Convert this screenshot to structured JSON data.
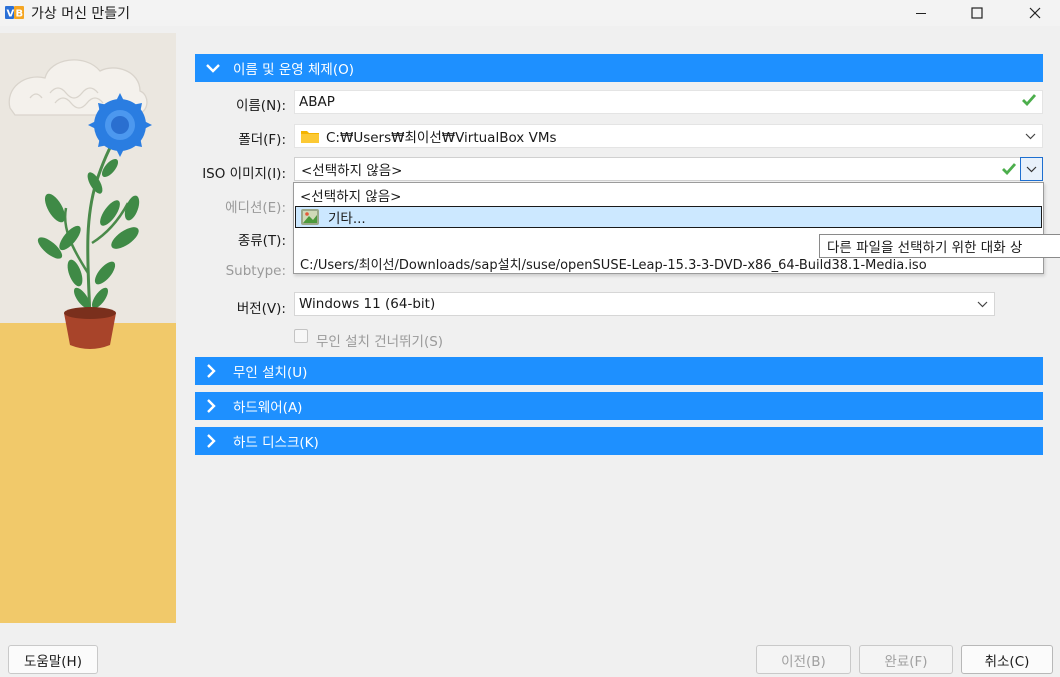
{
  "window": {
    "title": "가상 머신 만들기"
  },
  "sections": {
    "name_os": "이름 및 운영 체제(O)",
    "unattended": "무인 설치(U)",
    "hardware": "하드웨어(A)",
    "harddisk": "하드 디스크(K)"
  },
  "form": {
    "name_label": "이름(N):",
    "name_value": "ABAP",
    "folder_label": "폴더(F):",
    "folder_value": "C:₩Users₩최이선₩VirtualBox VMs",
    "iso_label": "ISO 이미지(I):",
    "iso_value": "<선택하지 않음>",
    "edition_label": "에디션(E):",
    "type_label": "종류(T):",
    "subtype_label": "Subtype:",
    "version_label": "버전(V):",
    "version_value": "Windows 11 (64-bit)",
    "skip_unattended_label": "무인 설치 건너뛰기(S)"
  },
  "iso_dropdown": {
    "items": [
      "<선택하지 않음>",
      "기타...",
      "C:/Users/최이선/Downloads/sap설치/suse/openSUSE-Leap-15.3-3-DVD-x86_64-Build38.1-Media.iso"
    ],
    "tooltip": "다른 파일을 선택하기 위한 대화 상"
  },
  "buttons": {
    "help": "도움말(H)",
    "back": "이전(B)",
    "finish": "완료(F)",
    "cancel": "취소(C)"
  },
  "colors": {
    "section_blue": "#1e90ff",
    "valid_green": "#5cb85c",
    "highlight": "#cce8ff"
  }
}
